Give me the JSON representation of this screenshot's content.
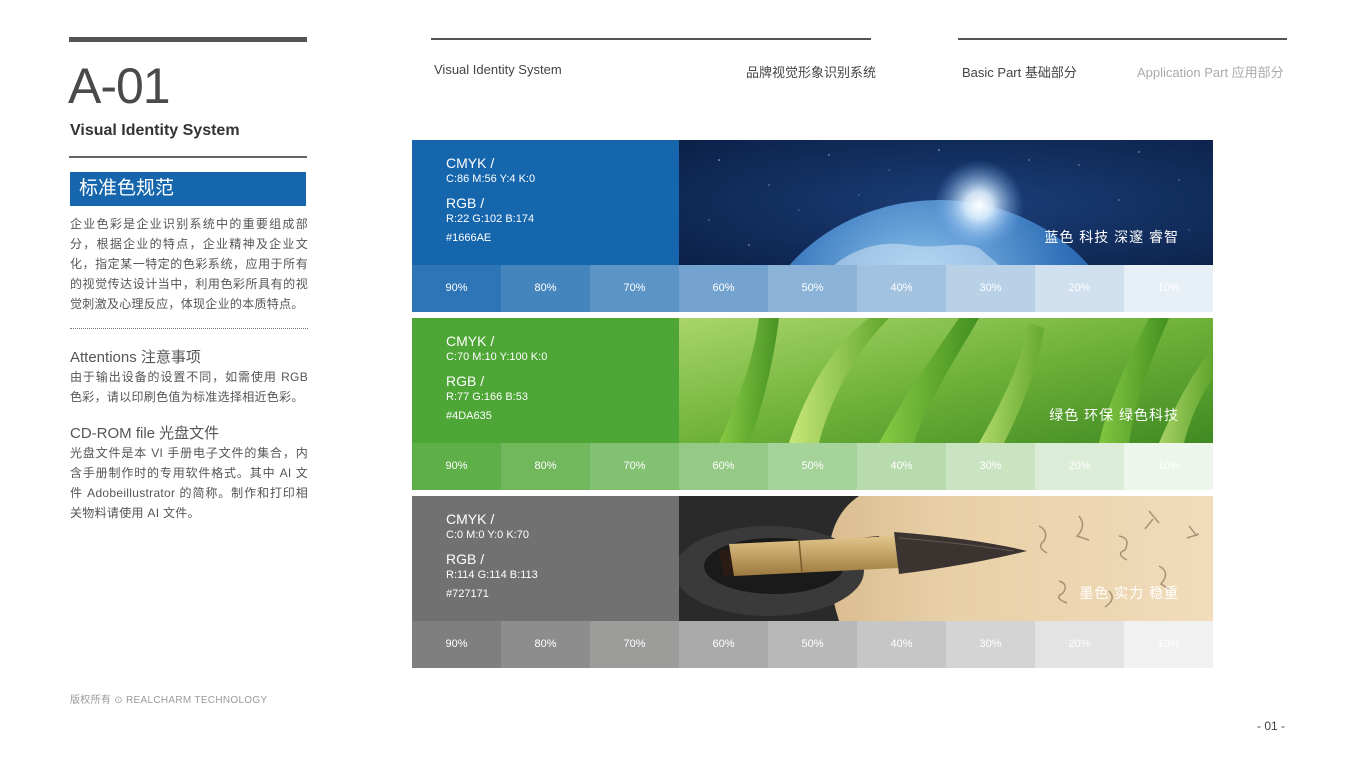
{
  "page": {
    "code": "A-01",
    "subtitle": "Visual Identity System",
    "section_title": "标准色规范",
    "intro": "企业色彩是企业识别系统中的重要组成部分，根据企业的特点，企业精神及企业文化，指定某一特定的色彩系统，应用于所有的视觉传达设计当中，利用色彩所具有的视觉刺激及心理反应，体现企业的本质特点。",
    "attentions_title": "Attentions 注意事项",
    "attentions_text": "由于输出设备的设置不同，如需使用 RGB 色彩，请以印刷色值为标准选择相近色彩。",
    "cdrom_title": "CD-ROM file 光盘文件",
    "cdrom_text": "光盘文件是本 VI 手册电子文件的集合，内含手册制作时的专用软件格式。其中 AI 文件 Adobeillustrator 的简称。制作和打印相关物料请使用 AI 文件。",
    "footer": "版权所有 ⊙ REALCHARM TECHNOLOGY",
    "page_number": "- 01 -"
  },
  "header": {
    "vis_en": "Visual Identity System",
    "vis_cn": "品牌视觉形象识别系统",
    "basic": "Basic Part 基础部分",
    "application": "Application Part 应用部分"
  },
  "colors": [
    {
      "cmyk_label": "CMYK /",
      "cmyk": "C:86 M:56 Y:4 K:0",
      "rgb_label": "RGB /",
      "rgb": "R:22 G:102 B:174",
      "hex": "#1666AE",
      "tagline": "蓝色 科技 深邃 睿智",
      "base": "#1666AE",
      "tints": [
        "90%",
        "80%",
        "70%",
        "60%",
        "50%",
        "40%",
        "30%",
        "20%",
        "10%"
      ]
    },
    {
      "cmyk_label": "CMYK /",
      "cmyk": "C:70 M:10 Y:100 K:0",
      "rgb_label": "RGB /",
      "rgb": "R:77 G:166 B:53",
      "hex": "#4DA635",
      "tagline": "绿色 环保 绿色科技",
      "base": "#4DA635",
      "tints": [
        "90%",
        "80%",
        "70%",
        "60%",
        "50%",
        "40%",
        "30%",
        "20%",
        "10%"
      ]
    },
    {
      "cmyk_label": "CMYK /",
      "cmyk": "C:0 M:0 Y:0 K:70",
      "rgb_label": "RGB /",
      "rgb": "R:114 G:114 B:113",
      "hex": "#727171",
      "tagline": "墨色 实力 稳重",
      "base": "#727171",
      "tints": [
        "90%",
        "80%",
        "70%",
        "60%",
        "50%",
        "40%",
        "30%",
        "20%",
        "10%"
      ]
    }
  ]
}
